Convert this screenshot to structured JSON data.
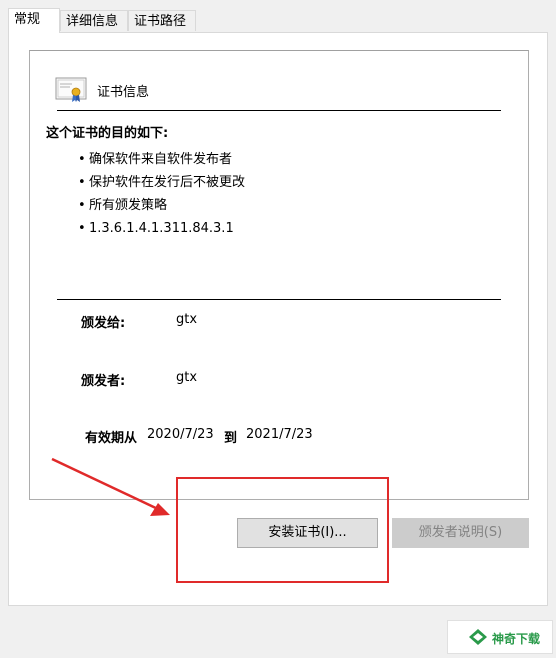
{
  "tabs": [
    {
      "label": "常规",
      "active": true
    },
    {
      "label": "详细信息",
      "active": false
    },
    {
      "label": "证书路径",
      "active": false
    }
  ],
  "certificate": {
    "title": "证书信息",
    "purpose_heading": "这个证书的目的如下:",
    "purposes": [
      "确保软件来自软件发布者",
      "保护软件在发行后不被更改",
      "所有颁发策略",
      "1.3.6.1.4.1.311.84.3.1"
    ],
    "issued_to_label": "颁发给:",
    "issued_to_value": "gtx",
    "issued_by_label": "颁发者:",
    "issued_by_value": "gtx",
    "valid_from_label": "有效期从",
    "valid_from_value": "2020/7/23",
    "valid_to_label": "到",
    "valid_to_value": "2021/7/23"
  },
  "buttons": {
    "install": "安装证书(I)...",
    "issuer_statement": "颁发者说明(S)"
  },
  "watermark": {
    "text": "神奇下载",
    "icon": "logo-icon"
  },
  "colors": {
    "annotation_red": "#e02a2a",
    "disabled_text": "#838383"
  }
}
